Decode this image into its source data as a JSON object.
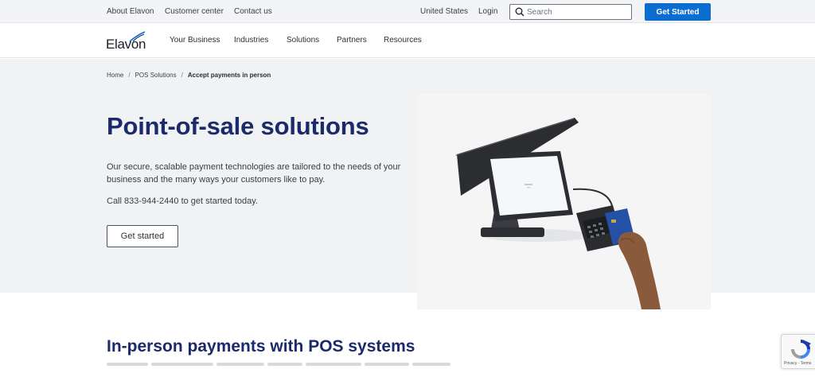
{
  "utility": {
    "links": [
      "About Elavon",
      "Customer center",
      "Contact us"
    ],
    "region": "United States",
    "login": "Login",
    "search_placeholder": "Search",
    "cta": "Get Started"
  },
  "nav": {
    "logo": "Elavon",
    "items": [
      "Your Business",
      "Industries",
      "Solutions",
      "Partners",
      "Resources"
    ]
  },
  "breadcrumb": {
    "home": "Home",
    "parent": "POS Solutions",
    "current": "Accept payments in person"
  },
  "hero": {
    "title": "Point-of-sale solutions",
    "description": "Our secure, scalable payment technologies are tailored to the needs of your business and the many ways your customers like to pay.",
    "call": "Call 833-944-2440 to get started today.",
    "button": "Get started"
  },
  "section": {
    "title": "In-person payments with POS systems"
  },
  "recaptcha": {
    "text": "Privacy - Terms"
  },
  "colors": {
    "brand_blue": "#0c6dd1",
    "heading_navy": "#1b2a6b",
    "hero_bg": "#f1f2f4"
  }
}
